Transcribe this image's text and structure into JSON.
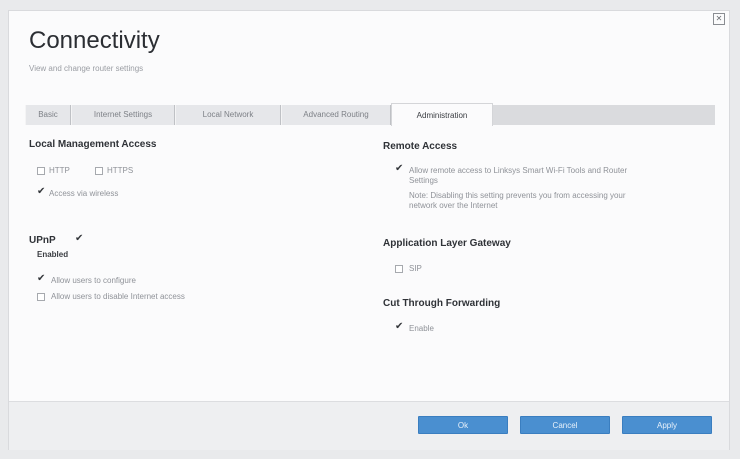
{
  "page": {
    "title": "Connectivity",
    "subtitle": "View and change router settings",
    "close_icon": "close-icon"
  },
  "tabs": [
    {
      "label": "Basic",
      "active": false
    },
    {
      "label": "Internet Settings",
      "active": false
    },
    {
      "label": "Local Network",
      "active": false
    },
    {
      "label": "Advanced Routing",
      "active": false
    },
    {
      "label": "Administration",
      "active": true
    }
  ],
  "local_management": {
    "heading": "Local Management Access",
    "http": {
      "label": "HTTP",
      "checked": false
    },
    "https": {
      "label": "HTTPS",
      "checked": false
    },
    "wireless": {
      "label": "Access via wireless",
      "checked": true
    }
  },
  "upnp": {
    "heading": "UPnP",
    "checked": true,
    "status": "Enabled",
    "configure": {
      "label": "Allow users to configure",
      "checked": true
    },
    "disable_internet": {
      "label": "Allow users to disable Internet access",
      "checked": false
    }
  },
  "remote_access": {
    "heading": "Remote Access",
    "checked": true,
    "label_line1": "Allow remote access to Linksys Smart Wi-Fi Tools and Router",
    "label_line2": "Settings",
    "note_line1": "Note: Disabling this setting prevents you from accessing your",
    "note_line2": "network over the Internet"
  },
  "alg": {
    "heading": "Application Layer Gateway",
    "sip": {
      "label": "SIP",
      "checked": false
    }
  },
  "ctf": {
    "heading": "Cut Through Forwarding",
    "enable": {
      "label": "Enable",
      "checked": true
    }
  },
  "buttons": {
    "ok": "Ok",
    "cancel": "Cancel",
    "apply": "Apply"
  },
  "colors": {
    "accent": "#4a8fd0",
    "background": "#fbfbfc"
  }
}
